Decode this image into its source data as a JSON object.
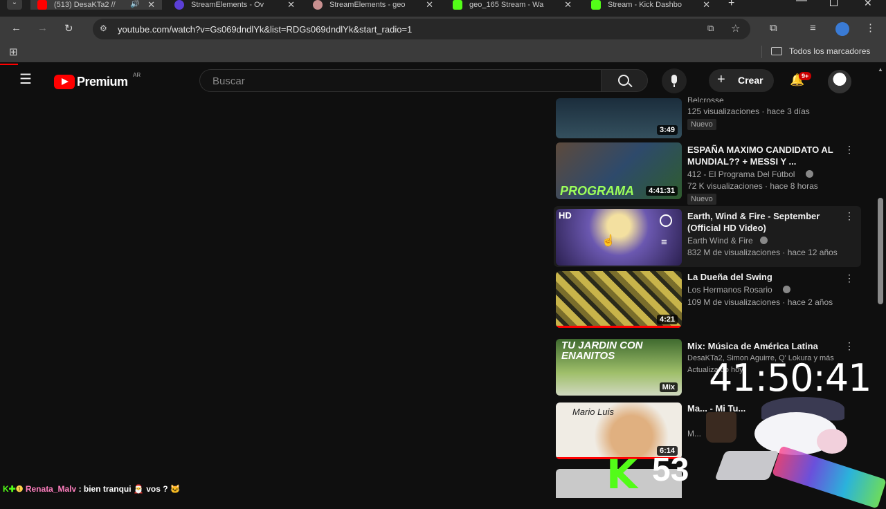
{
  "browser": {
    "tabs": [
      {
        "title": "(513) DesaKTa2 //",
        "favicon_color": "#ff0000"
      },
      {
        "title": "StreamElements - Ov",
        "favicon_color": "#5b3fd6"
      },
      {
        "title": "StreamElements - geo",
        "favicon_color": "#c89090"
      },
      {
        "title": "geo_165 Stream - Wa",
        "favicon_color": "#53fc18"
      },
      {
        "title": "Stream - Kick Dashbo",
        "favicon_color": "#53fc18"
      }
    ],
    "url": "youtube.com/watch?v=Gs069dndlYk&list=RDGs069dndlYk&start_radio=1",
    "bookmarks_label": "Todos los marcadores"
  },
  "youtube": {
    "logo_text": "Premium",
    "region": "AR",
    "search_placeholder": "Buscar",
    "create_label": "Crear",
    "notif_count": "9+"
  },
  "videos": [
    {
      "title": "",
      "channel": "Belcrosse",
      "meta": "125 visualizaciones · hace 3 días",
      "duration": "3:49",
      "badge": "Nuevo",
      "thumb": "#233a4a"
    },
    {
      "title": "ESPAÑA MAXIMO CANDIDATO AL MUNDIAL?? + MESSI Y ...",
      "channel": "412 - El Programa Del Fútbol",
      "meta": "72 K visualizaciones · hace 8 horas",
      "duration": "4:41:31",
      "badge": "Nuevo",
      "thumb": "#3b5d3a",
      "overlay_text": "PROGRAMA"
    },
    {
      "title": "Earth, Wind & Fire - September (Official HD Video)",
      "channel": "Earth Wind & Fire",
      "meta": "832 M de visualizaciones · hace 12 años",
      "duration": "",
      "badge": "",
      "thumb": "#4a3f7a",
      "overlay_text": "HD"
    },
    {
      "title": "La Dueña del Swing",
      "channel": "Los Hermanos Rosario",
      "meta": "109 M de visualizaciones · hace 2 años",
      "duration": "4:21",
      "badge": "",
      "thumb": "#6b5a1c"
    },
    {
      "title": "Mix: Música de América Latina",
      "channel": "DesaKTa2, Simon Aguirre, Q' Lokura y más",
      "meta": "Actualiza do hoy",
      "duration": "Mix",
      "badge": "",
      "thumb": "#4c6f40",
      "overlay_text": "TU JARDIN CON ENANITOS"
    },
    {
      "title": "Ma... - Mi Tu...",
      "channel": "M...",
      "meta": "",
      "duration": "6:14",
      "badge": "",
      "thumb": "#d8d0c4",
      "overlay_text": "Mario Luis"
    }
  ],
  "overlay": {
    "timer": "41:50:41",
    "kick_count": "53",
    "chat_user": "Renata_Malv",
    "chat_message": ": bien tranqui",
    "chat_tail": "vos ?"
  },
  "colors": {
    "youtube_red": "#ff0000",
    "kick_green": "#53fc18",
    "chat_user": "#ff7fbf"
  }
}
